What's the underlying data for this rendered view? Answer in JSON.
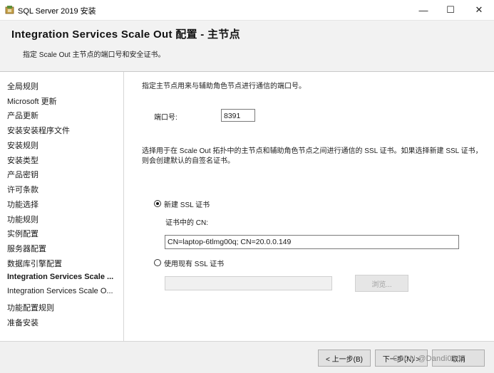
{
  "window": {
    "title": "SQL Server 2019 安装",
    "minimize": "—",
    "maximize": "☐",
    "close": "✕"
  },
  "header": {
    "title": "Integration Services Scale Out 配置 - 主节点",
    "description": "指定 Scale Out 主节点的端口号和安全证书。"
  },
  "sidebar": {
    "items": [
      {
        "label": "全局规则",
        "bold": false
      },
      {
        "label": "Microsoft 更新",
        "bold": false
      },
      {
        "label": "产品更新",
        "bold": false
      },
      {
        "label": "安装安装程序文件",
        "bold": false
      },
      {
        "label": "安装规则",
        "bold": false
      },
      {
        "label": "安装类型",
        "bold": false
      },
      {
        "label": "产品密钥",
        "bold": false
      },
      {
        "label": "许可条款",
        "bold": false
      },
      {
        "label": "功能选择",
        "bold": false
      },
      {
        "label": "功能规则",
        "bold": false
      },
      {
        "label": "实例配置",
        "bold": false
      },
      {
        "label": "服务器配置",
        "bold": false
      },
      {
        "label": "数据库引擎配置",
        "bold": false
      },
      {
        "label": "Integration Services Scale ...",
        "bold": true
      },
      {
        "label": "Integration Services Scale O...",
        "bold": false
      },
      {
        "label": "功能配置规则",
        "bold": false
      },
      {
        "label": "准备安装",
        "bold": false
      }
    ]
  },
  "content": {
    "intro": "指定主节点用来与辅助角色节点进行通信的端口号。",
    "port_label": "端口号:",
    "port_value": "8391",
    "ssl_description": "选择用于在 Scale Out 拓扑中的主节点和辅助角色节点之间进行通信的 SSL 证书。如果选择新建 SSL 证书，则会创建默认的自签名证书。",
    "new_ssl_label": "新建 SSL 证书",
    "new_ssl_selected": true,
    "cn_label": "证书中的 CN:",
    "cn_value": "CN=laptop-6tlmg00q; CN=20.0.0.149",
    "existing_ssl_label": "使用现有 SSL 证书",
    "existing_ssl_selected": false,
    "existing_value": "",
    "browse_label": "浏览..."
  },
  "footer": {
    "back_label": "< 上一步(B)",
    "next_label": "下一步(N) >",
    "cancel_label": "取消"
  },
  "watermark": "CSDN @Dandi0707"
}
